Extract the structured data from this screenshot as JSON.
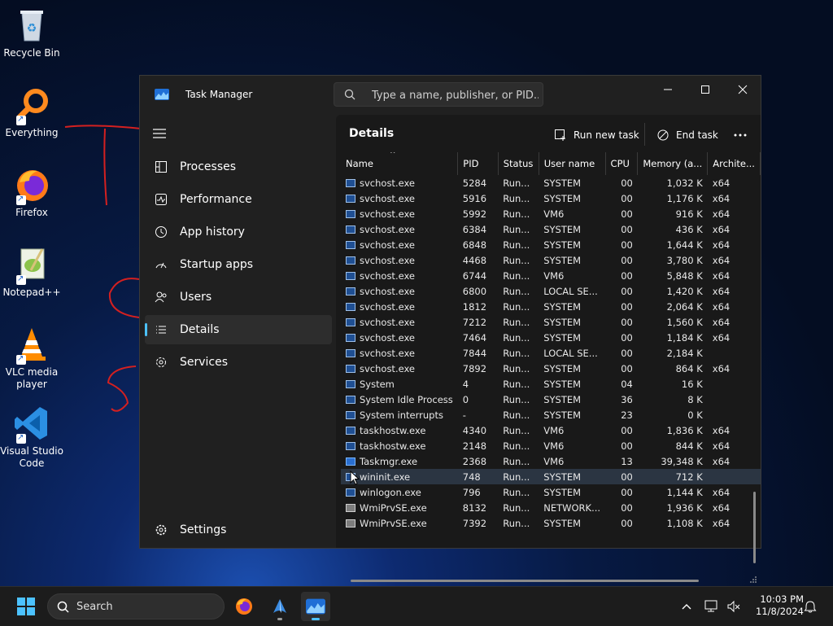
{
  "desktop": {
    "icons": [
      {
        "label": "Recycle Bin",
        "icon": "recycle-bin-icon"
      },
      {
        "label": "Everything",
        "icon": "everything-search-icon"
      },
      {
        "label": "Firefox",
        "icon": "firefox-icon"
      },
      {
        "label": "Notepad++",
        "icon": "notepad-plus-plus-icon"
      },
      {
        "label": "VLC media player",
        "icon": "vlc-cone-icon"
      },
      {
        "label": "Visual Studio Code",
        "icon": "vscode-icon"
      }
    ]
  },
  "window": {
    "title": "Task Manager",
    "search_placeholder": "Type a name, publisher, or PID..."
  },
  "sidebar": {
    "items": [
      {
        "label": "Processes",
        "icon": "processes-icon"
      },
      {
        "label": "Performance",
        "icon": "performance-icon"
      },
      {
        "label": "App history",
        "icon": "app-history-icon"
      },
      {
        "label": "Startup apps",
        "icon": "startup-apps-icon"
      },
      {
        "label": "Users",
        "icon": "users-icon"
      },
      {
        "label": "Details",
        "icon": "details-icon",
        "active": true
      },
      {
        "label": "Services",
        "icon": "services-icon"
      }
    ],
    "settings_label": "Settings"
  },
  "details": {
    "title": "Details",
    "run_new_task": "Run new task",
    "end_task": "End task",
    "columns": [
      "Name",
      "PID",
      "Status",
      "User name",
      "CPU",
      "Memory (a...",
      "Archite..."
    ],
    "rows": [
      [
        "svchost.exe",
        "5284",
        "Run...",
        "SYSTEM",
        "00",
        "1,032 K",
        "x64"
      ],
      [
        "svchost.exe",
        "5916",
        "Run...",
        "SYSTEM",
        "00",
        "1,176 K",
        "x64"
      ],
      [
        "svchost.exe",
        "5992",
        "Run...",
        "VM6",
        "00",
        "916 K",
        "x64"
      ],
      [
        "svchost.exe",
        "6384",
        "Run...",
        "SYSTEM",
        "00",
        "436 K",
        "x64"
      ],
      [
        "svchost.exe",
        "6848",
        "Run...",
        "SYSTEM",
        "00",
        "1,644 K",
        "x64"
      ],
      [
        "svchost.exe",
        "4468",
        "Run...",
        "SYSTEM",
        "00",
        "3,780 K",
        "x64"
      ],
      [
        "svchost.exe",
        "6744",
        "Run...",
        "VM6",
        "00",
        "5,848 K",
        "x64"
      ],
      [
        "svchost.exe",
        "6800",
        "Run...",
        "LOCAL SE...",
        "00",
        "1,420 K",
        "x64"
      ],
      [
        "svchost.exe",
        "1812",
        "Run...",
        "SYSTEM",
        "00",
        "2,064 K",
        "x64"
      ],
      [
        "svchost.exe",
        "7212",
        "Run...",
        "SYSTEM",
        "00",
        "1,560 K",
        "x64"
      ],
      [
        "svchost.exe",
        "7464",
        "Run...",
        "SYSTEM",
        "00",
        "1,184 K",
        "x64"
      ],
      [
        "svchost.exe",
        "7844",
        "Run...",
        "LOCAL SE...",
        "00",
        "2,184 K",
        ""
      ],
      [
        "svchost.exe",
        "7892",
        "Run...",
        "SYSTEM",
        "00",
        "864 K",
        "x64"
      ],
      [
        "System",
        "4",
        "Run...",
        "SYSTEM",
        "04",
        "16 K",
        ""
      ],
      [
        "System Idle Process",
        "0",
        "Run...",
        "SYSTEM",
        "36",
        "8 K",
        ""
      ],
      [
        "System interrupts",
        "-",
        "Run...",
        "SYSTEM",
        "23",
        "0 K",
        ""
      ],
      [
        "taskhostw.exe",
        "4340",
        "Run...",
        "VM6",
        "00",
        "1,836 K",
        "x64"
      ],
      [
        "taskhostw.exe",
        "2148",
        "Run...",
        "VM6",
        "00",
        "844 K",
        "x64"
      ],
      [
        "Taskmgr.exe",
        "2368",
        "Run...",
        "VM6",
        "13",
        "39,348 K",
        "x64"
      ],
      [
        "wininit.exe",
        "748",
        "Run...",
        "SYSTEM",
        "00",
        "712 K",
        ""
      ],
      [
        "winlogon.exe",
        "796",
        "Run...",
        "SYSTEM",
        "00",
        "1,144 K",
        "x64"
      ],
      [
        "WmiPrvSE.exe",
        "8132",
        "Run...",
        "NETWORK...",
        "00",
        "1,936 K",
        "x64"
      ],
      [
        "WmiPrvSE.exe",
        "7392",
        "Run...",
        "SYSTEM",
        "00",
        "1,108 K",
        "x64"
      ]
    ],
    "selected_row": 19
  },
  "taskbar": {
    "search_label": "Search",
    "time": "10:03 PM",
    "date": "11/8/2024"
  },
  "colors": {
    "accent": "#4cc2ff",
    "annotation_red": "#d42020",
    "window_bg": "#202020",
    "content_bg": "#191919",
    "selected_row": "#2b3542"
  }
}
